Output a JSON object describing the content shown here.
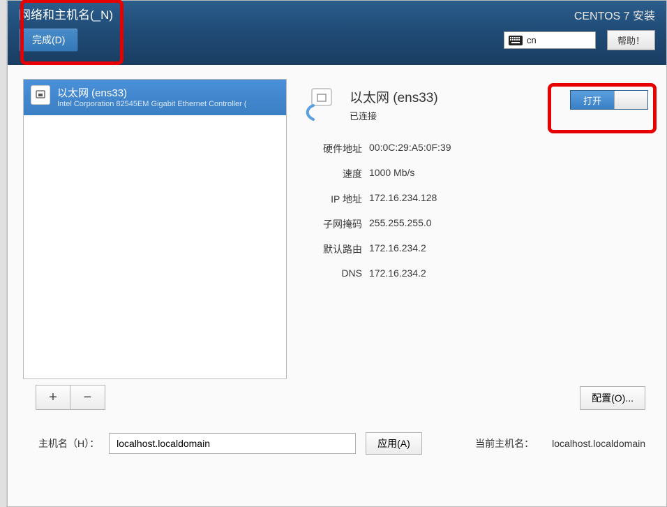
{
  "header": {
    "page_title": "网络和主机名(_N)",
    "done_label": "完成(D)",
    "install_title": "CENTOS 7 安装",
    "locale": "cn",
    "help_label": "帮助！"
  },
  "device_list": {
    "items": [
      {
        "title": "以太网 (ens33)",
        "subtitle": "Intel Corporation 82545EM Gigabit Ethernet Controller ("
      }
    ],
    "add_label": "+",
    "remove_label": "−"
  },
  "detail": {
    "title": "以太网 (ens33)",
    "status": "已连接",
    "toggle_on_label": "打开",
    "rows": {
      "hw_label": "硬件地址",
      "hw_value": "00:0C:29:A5:0F:39",
      "speed_label": "速度",
      "speed_value": "1000 Mb/s",
      "ip_label": "IP 地址",
      "ip_value": "172.16.234.128",
      "mask_label": "子网掩码",
      "mask_value": "255.255.255.0",
      "gw_label": "默认路由",
      "gw_value": "172.16.234.2",
      "dns_label": "DNS",
      "dns_value": "172.16.234.2"
    },
    "configure_label": "配置(O)..."
  },
  "hostname": {
    "label": "主机名（H）：",
    "value": "localhost.localdomain",
    "apply_label": "应用(A)",
    "current_label": "当前主机名：",
    "current_value": "localhost.localdomain"
  }
}
